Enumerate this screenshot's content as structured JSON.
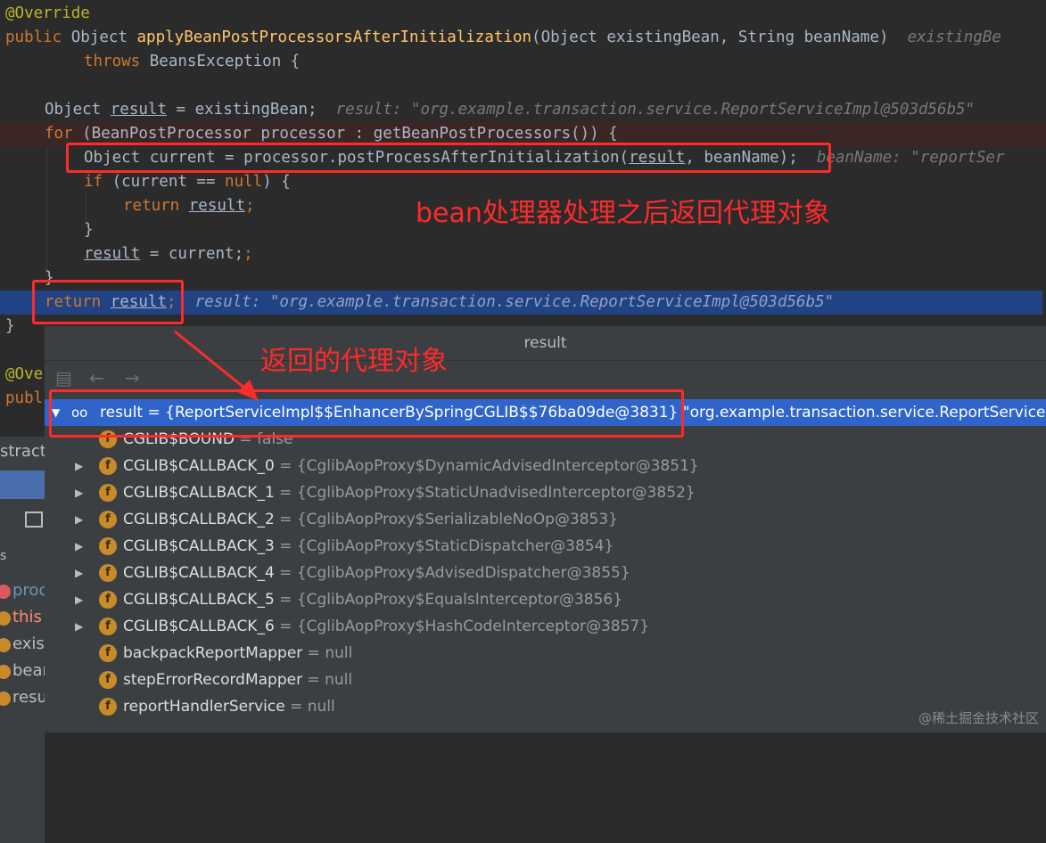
{
  "code": {
    "annotation": "@Override",
    "sig_public": "public",
    "sig_rest": " Object ",
    "sig_method": "applyBeanPostProcessorsAfterInitialization",
    "sig_params": "(Object existingBean, String beanName)",
    "sig_hint": "existingBe",
    "throws_kw": "throws",
    "throws_rest": " BeansException {",
    "l4_pre": "Object ",
    "l4_var": "result",
    "l4_post": " = existingBean;",
    "l4_hint": "result: \"org.example.transaction.service.ReportServiceImpl@503d56b5\"",
    "l5_kw": "for",
    "l5_post": " (BeanPostProcessor processor : getBeanPostProcessors()) {",
    "l6_pre": "Object current = processor.postProcessAfterInitialization(",
    "l6_var": "result",
    "l6_post": ", beanName);",
    "l6_hint": "beanName: \"reportSer",
    "l7_kw": "if",
    "l7_post": " (current == ",
    "l7_null": "null",
    "l7_end": ") {",
    "l8_kw": "return",
    "l8_var": "result",
    "l8_end": ";",
    "l9": "}",
    "l10_var": "result",
    "l10_post": " = current;",
    "l11": "}",
    "l12_kw": "return",
    "l12_var": "result",
    "l12_end": ";",
    "l12_hint": "result: \"org.example.transaction.service.ReportServiceImpl@503d56b5\"",
    "l13": "}",
    "l14_ann": "@Ove",
    "l15_kw": "publ"
  },
  "annotations": {
    "text1": "bean处理器处理之后返回代理对象",
    "text2": "返回的代理对象"
  },
  "panel": {
    "title": "result",
    "root_name": "result",
    "root_value": " = {ReportServiceImpl$$EnhancerBySpringCGLIB$$76ba09de@3831} ",
    "root_tail": "\"org.example.transaction.service.ReportServiceIm",
    "fields": [
      {
        "name": "CGLIB$BOUND",
        "value": " = false",
        "expandable": false
      },
      {
        "name": "CGLIB$CALLBACK_0",
        "value": " = {CglibAopProxy$DynamicAdvisedInterceptor@3851}",
        "expandable": true
      },
      {
        "name": "CGLIB$CALLBACK_1",
        "value": " = {CglibAopProxy$StaticUnadvisedInterceptor@3852}",
        "expandable": true
      },
      {
        "name": "CGLIB$CALLBACK_2",
        "value": " = {CglibAopProxy$SerializableNoOp@3853}",
        "expandable": true
      },
      {
        "name": "CGLIB$CALLBACK_3",
        "value": " = {CglibAopProxy$StaticDispatcher@3854}",
        "expandable": true
      },
      {
        "name": "CGLIB$CALLBACK_4",
        "value": " = {CglibAopProxy$AdvisedDispatcher@3855}",
        "expandable": true
      },
      {
        "name": "CGLIB$CALLBACK_5",
        "value": " = {CglibAopProxy$EqualsInterceptor@3856}",
        "expandable": true
      },
      {
        "name": "CGLIB$CALLBACK_6",
        "value": " = {CglibAopProxy$HashCodeInterceptor@3857}",
        "expandable": true
      },
      {
        "name": "backpackReportMapper",
        "value": " = null",
        "expandable": false
      },
      {
        "name": "stepErrorRecordMapper",
        "value": " = null",
        "expandable": false
      },
      {
        "name": "reportHandlerService",
        "value": " = null",
        "expandable": false
      }
    ],
    "f_badge": "f"
  },
  "left": {
    "tab_fragment": "stractA",
    "s_label": "s",
    "vars": [
      "proc",
      "this",
      "exist",
      "bear",
      "resu"
    ]
  },
  "watermark": "@稀土掘金技术社区",
  "icons": [
    "back-arrow-icon",
    "forward-arrow-icon",
    "glasses-icon",
    "field-icon",
    "expand-arrow-icon",
    "calculator-icon"
  ],
  "colors": {
    "keyword": "#cc7832",
    "method": "#ffc66d",
    "annotation": "#bbb529",
    "highlight": "#214283",
    "selected": "#2f65ca",
    "red_markup": "#ff2a2a"
  }
}
